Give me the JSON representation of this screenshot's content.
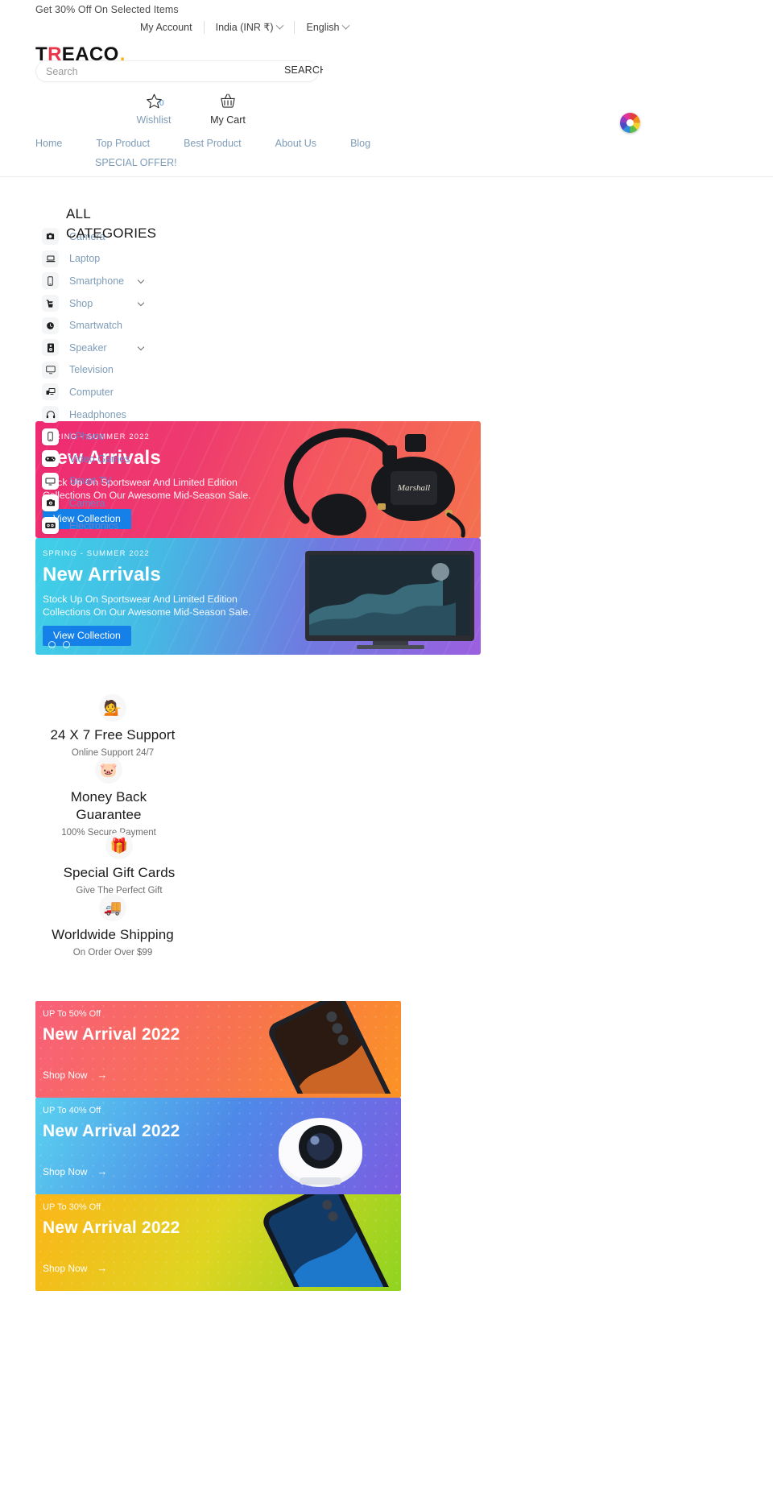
{
  "topbar": {
    "promo": "Get 30% Off On Selected Items",
    "account": "My Account",
    "currency": "India (INR ₹)",
    "language": "English"
  },
  "brand": {
    "logo_pre": "T",
    "logo_r": "R",
    "logo_post": "EACO",
    "logo_dot": "."
  },
  "search": {
    "placeholder": "Search",
    "value": "",
    "button": "SEARCH"
  },
  "utility": {
    "wishlist_label": "Wishlist",
    "wishlist_count": "0",
    "cart_label": "My Cart"
  },
  "nav": {
    "items": [
      {
        "label": "Home"
      },
      {
        "label": "Top Product"
      },
      {
        "label": "Best Product"
      },
      {
        "label": "About Us"
      },
      {
        "label": "Blog"
      }
    ],
    "special": "SPECIAL OFFER!"
  },
  "categories": {
    "title": "ALL CATEGORIES",
    "items": [
      {
        "label": "Camera",
        "icon": "camera-icon",
        "caret": false,
        "over": false
      },
      {
        "label": "Laptop",
        "icon": "laptop-icon",
        "caret": false,
        "over": false
      },
      {
        "label": "Smartphone",
        "icon": "smartphone-icon",
        "caret": true,
        "over": false
      },
      {
        "label": "Shop",
        "icon": "shop-icon",
        "caret": true,
        "over": false
      },
      {
        "label": "Smartwatch",
        "icon": "smartwatch-icon",
        "caret": false,
        "over": false
      },
      {
        "label": "Speaker",
        "icon": "speaker-icon",
        "caret": true,
        "over": false
      },
      {
        "label": "Television",
        "icon": "television-icon",
        "caret": false,
        "over": false
      },
      {
        "label": "Computer",
        "icon": "computer-icon",
        "caret": false,
        "over": false
      },
      {
        "label": "Headphones",
        "icon": "headphones-icon",
        "caret": false,
        "over": false
      },
      {
        "label": "I-Phone",
        "icon": "iphone-icon",
        "caret": false,
        "over": true
      },
      {
        "label": "Video Games",
        "icon": "gamepad-icon",
        "caret": false,
        "over": true
      },
      {
        "label": "Smart TV",
        "icon": "smart-tv-icon",
        "caret": false,
        "over": true
      },
      {
        "label": "Camera",
        "icon": "camera-alt-icon",
        "caret": false,
        "over": true
      },
      {
        "label": "Electronics",
        "icon": "electronics-icon",
        "caret": false,
        "over": true
      }
    ]
  },
  "hero": {
    "slides": [
      {
        "kicker": "SPRING - SUMMER 2022",
        "title": "New Arrivals",
        "subtitle": "Stock Up On Sportswear And Limited Edition Collections On Our Awesome Mid-Season Sale.",
        "cta": "View Collection",
        "product": "marshall-headphones"
      },
      {
        "kicker": "SPRING - SUMMER 2022",
        "title": "New Arrivals",
        "subtitle": "Stock Up On Sportswear And Limited Edition Collections On Our Awesome Mid-Season Sale.",
        "cta": "View Collection",
        "product": "flat-screen-television"
      }
    ],
    "dots": [
      "inactive",
      "inactive"
    ]
  },
  "features": [
    {
      "icon": "headset-support-icon",
      "glyph": "💁",
      "title": "24 X 7 Free Support",
      "sub": "Online Support 24/7"
    },
    {
      "icon": "piggy-bank-icon",
      "glyph": "🐷",
      "title": "Money Back Guarantee",
      "sub": "100% Secure Payment"
    },
    {
      "icon": "gift-box-icon",
      "glyph": "🎁",
      "title": "Special Gift Cards",
      "sub": "Give The Perfect Gift"
    },
    {
      "icon": "delivery-truck-icon",
      "glyph": "🚚",
      "title": "Worldwide Shipping",
      "sub": "On Order Over $99"
    }
  ],
  "promos": [
    {
      "kicker": "UP To 50% Off",
      "title": "New Arrival 2022",
      "cta": "Shop Now",
      "arrow": "→",
      "product": "smartphone"
    },
    {
      "kicker": "UP To 40% Off",
      "title": "New Arrival 2022",
      "cta": "Shop Now",
      "arrow": "→",
      "product": "security-camera"
    },
    {
      "kicker": "UP To 30% Off",
      "title": "New Arrival 2022",
      "cta": "Shop Now",
      "arrow": "→",
      "product": "smartphone-blue"
    }
  ],
  "colors": {
    "accent_blue": "#1580e8",
    "link_blue": "#7e9cb8",
    "logo_red": "#e8354a",
    "logo_yellow": "#f5b51b"
  }
}
